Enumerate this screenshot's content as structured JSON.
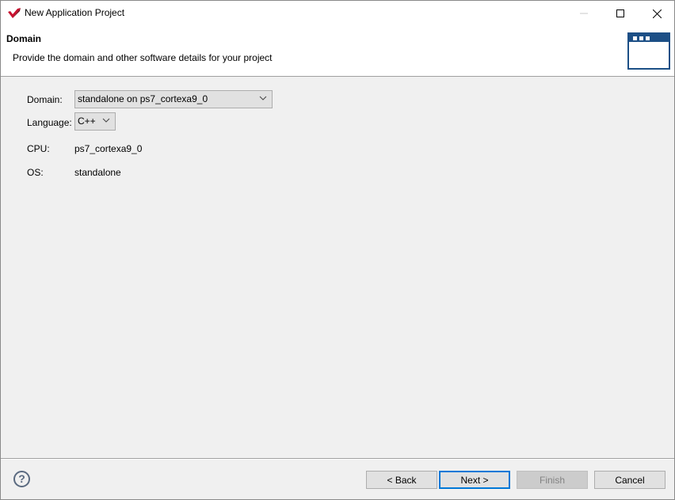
{
  "window": {
    "title": "New Application Project",
    "controls": {
      "minimize": "minimize-icon",
      "maximize": "maximize-icon",
      "close": "close-icon"
    }
  },
  "header": {
    "title": "Domain",
    "description": "Provide the domain and other software details for your project"
  },
  "form": {
    "domain": {
      "label": "Domain:",
      "value": "standalone on ps7_cortexa9_0"
    },
    "language": {
      "label": "Language:",
      "value": "C++"
    },
    "cpu": {
      "label": "CPU:",
      "value": "ps7_cortexa9_0"
    },
    "os": {
      "label": "OS:",
      "value": "standalone"
    }
  },
  "footer": {
    "help": "?",
    "back": "< Back",
    "next": "Next >",
    "finish": "Finish",
    "cancel": "Cancel"
  },
  "colors": {
    "accent": "#0078d7",
    "banner": "#1c4f86",
    "logo": "#c8102e"
  }
}
